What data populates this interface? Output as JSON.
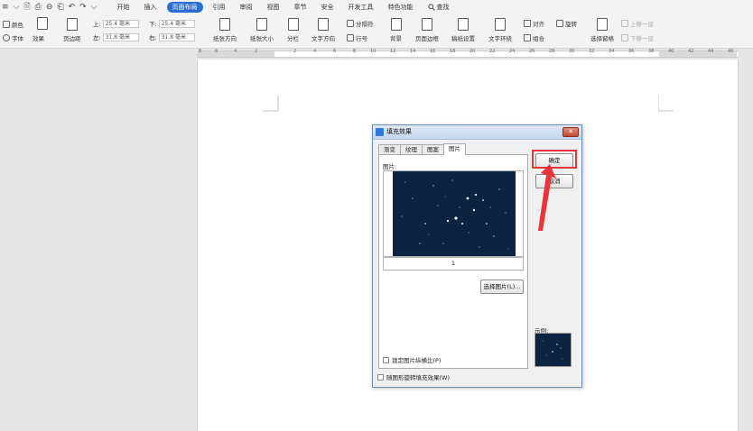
{
  "menubar": {
    "quick_icons": [
      "≡",
      "⌵",
      "🗎",
      "⎙",
      "⊖",
      "⎗",
      "↶",
      "↷",
      "⌵"
    ],
    "tabs": [
      {
        "label": "开始",
        "active": false
      },
      {
        "label": "插入",
        "active": false
      },
      {
        "label": "页面布局",
        "active": true
      },
      {
        "label": "引用",
        "active": false
      },
      {
        "label": "审阅",
        "active": false
      },
      {
        "label": "视图",
        "active": false
      },
      {
        "label": "章节",
        "active": false
      },
      {
        "label": "安全",
        "active": false
      },
      {
        "label": "开发工具",
        "active": false
      },
      {
        "label": "特色功能",
        "active": false
      }
    ],
    "search_label": "查找"
  },
  "ribbon": {
    "color_label": "颜色",
    "font_label": "字体",
    "effect_label": "效果",
    "margins_label": "页边距",
    "top_label": "上:",
    "top_value": "25.4 毫米",
    "bottom_label": "下:",
    "bottom_value": "25.4 毫米",
    "left_label": "左:",
    "left_value": "31.8 毫米",
    "right_label": "右:",
    "right_value": "31.8 毫米",
    "orientation_label": "纸张方向",
    "size_label": "纸张大小",
    "columns_label": "分栏",
    "text_direction_label": "文字方向",
    "separator_label": "分隔符",
    "line_numbers_label": "行号",
    "background_label": "背景",
    "page_border_label": "页面边框",
    "paper_setup_label": "稿纸设置",
    "text_wrap_label": "文字环绕",
    "align_label": "对齐",
    "rotate_label": "旋转",
    "group_label": "组合",
    "selection_pane_label": "选择窗格",
    "bring_forward_label": "上移一层",
    "send_backward_label": "下移一层"
  },
  "ruler": {
    "numbers": [
      "8",
      "6",
      "4",
      "2",
      "",
      "2",
      "4",
      "6",
      "8",
      "10",
      "12",
      "14",
      "16",
      "18",
      "20",
      "22",
      "24",
      "26",
      "28",
      "30",
      "32",
      "34",
      "36",
      "38",
      "40",
      "42",
      "44",
      "46"
    ]
  },
  "dialog": {
    "title": "填充效果",
    "close_glyph": "✕",
    "tabs": [
      {
        "label": "渐变",
        "active": false
      },
      {
        "label": "纹理",
        "active": false
      },
      {
        "label": "图案",
        "active": false
      },
      {
        "label": "图片",
        "active": true
      }
    ],
    "picture_label": "图片:",
    "page_number": "1",
    "select_picture_button": "选择图片(L)...",
    "lock_aspect_label": "锁定图片纵横比(P)",
    "rotate_with_shape_label": "随图形旋转填充效果(W)",
    "ok_button": "确定",
    "cancel_button": "取消",
    "sample_label": "示例:"
  },
  "colors": {
    "accent": "#2b6fd6",
    "highlight": "#e8343a",
    "night_sky": "#0d2440"
  }
}
